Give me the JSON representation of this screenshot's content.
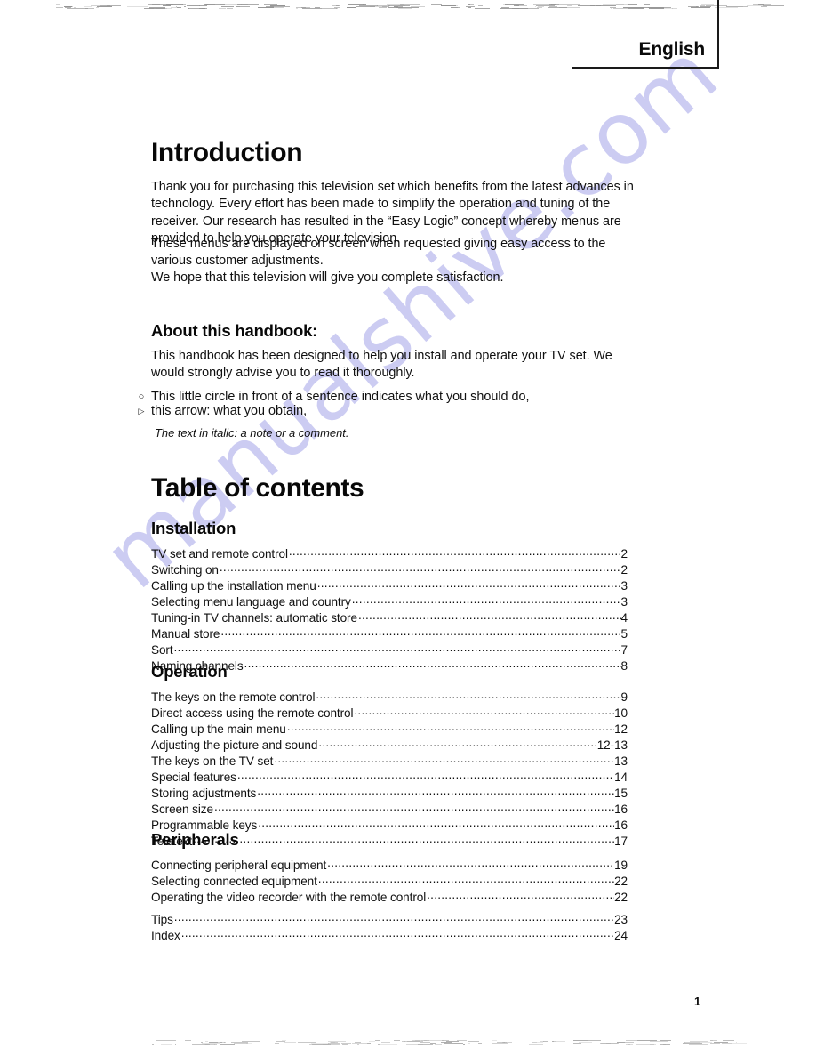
{
  "header": {
    "language_tab": "English"
  },
  "introduction": {
    "title": "Introduction",
    "paragraph1": "Thank you for purchasing this television set which benefits from the latest advances in technology. Every effort has been made to simplify the operation and tuning of the receiver. Our research has resulted in the “Easy Logic” concept whereby menus are provided to help you operate your television.",
    "paragraph2": "These menus are displayed on screen when requested giving easy access to the various customer adjustments.",
    "paragraph3": "We hope that this television will give you complete satisfaction."
  },
  "about_handbook": {
    "title": "About this handbook:",
    "paragraph": "This handbook has been designed to help you install and operate your TV set. We would strongly advise you to read it thoroughly.",
    "markers": [
      {
        "glyph": "○",
        "glyph_name": "circle-marker",
        "text": "This little circle in front of a sentence indicates what you should do,"
      },
      {
        "glyph": "▷",
        "glyph_name": "arrow-marker",
        "text": "this arrow: what you obtain,"
      }
    ],
    "italic_note": "The text in italic: a note or a comment."
  },
  "table_of_contents": {
    "title": "Table of contents",
    "sections": [
      {
        "heading": "Installation",
        "entries": [
          {
            "label": "TV set and remote control",
            "page": "2"
          },
          {
            "label": "Switching on",
            "page": "2"
          },
          {
            "label": "Calling up the installation menu",
            "page": "3"
          },
          {
            "label": "Selecting menu language and country",
            "page": "3"
          },
          {
            "label": "Tuning-in TV channels: automatic store",
            "page": "4"
          },
          {
            "label": "Manual store",
            "page": "5"
          },
          {
            "label": "Sort",
            "page": "7"
          },
          {
            "label": "Naming channels",
            "page": "8"
          }
        ]
      },
      {
        "heading": "Operation",
        "entries": [
          {
            "label": "The keys on the remote control",
            "page": "9"
          },
          {
            "label": "Direct access using the remote control",
            "page": "10"
          },
          {
            "label": "Calling up the main menu",
            "page": "12"
          },
          {
            "label": "Adjusting the picture and sound",
            "page": "12-13"
          },
          {
            "label": "The keys on the TV set",
            "page": "13"
          },
          {
            "label": "Special features",
            "page": "14"
          },
          {
            "label": "Storing adjustments",
            "page": "15"
          },
          {
            "label": "Screen size",
            "page": "16"
          },
          {
            "label": "Programmable keys",
            "page": "16"
          },
          {
            "label": "Teletext",
            "page": "17"
          }
        ]
      },
      {
        "heading": "Peripherals",
        "entries": [
          {
            "label": "Connecting peripheral equipment",
            "page": "19"
          },
          {
            "label": "Selecting connected equipment",
            "page": "22"
          },
          {
            "label": "Operating the video recorder with the remote control",
            "page": "22"
          },
          {
            "label": "Tips",
            "page": "23",
            "gap_before": true
          },
          {
            "label": "Index",
            "page": "24"
          }
        ]
      }
    ]
  },
  "footer": {
    "page_number": "1"
  },
  "watermark": {
    "text": "manualshive.com",
    "color": "#ccccf2"
  }
}
